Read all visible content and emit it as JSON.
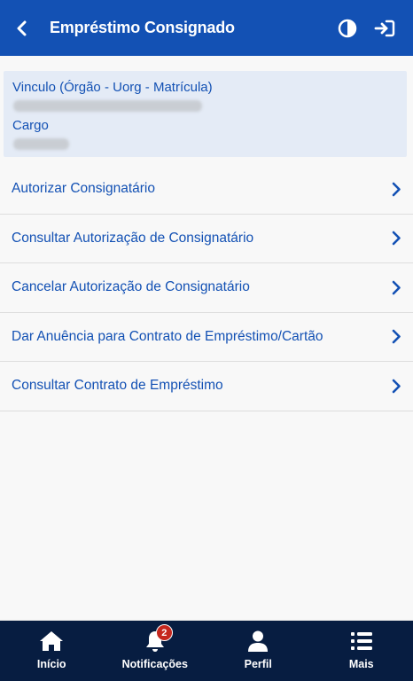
{
  "header": {
    "title": "Empréstimo Consignado",
    "background": "#1351b4",
    "icons": [
      "chevron-left-icon",
      "contrast-icon",
      "logout-icon"
    ]
  },
  "info_card": {
    "vinculo_label": "Vinculo (Órgão - Uorg - Matrícula)",
    "cargo_label": "Cargo"
  },
  "menu": {
    "items": [
      {
        "label": "Autorizar Consignatário"
      },
      {
        "label": "Consultar Autorização de Consignatário"
      },
      {
        "label": "Cancelar Autorização de Consignatário"
      },
      {
        "label": "Dar Anuência para Contrato de Empréstimo/Cartão"
      },
      {
        "label": "Consultar Contrato de Empréstimo"
      }
    ]
  },
  "bottom_nav": {
    "background": "#071d41",
    "items": [
      {
        "label": "Início",
        "icon": "home-icon"
      },
      {
        "label": "Notificações",
        "icon": "bell-icon",
        "badge": "2"
      },
      {
        "label": "Perfil",
        "icon": "user-icon"
      },
      {
        "label": "Mais",
        "icon": "list-icon"
      }
    ]
  }
}
